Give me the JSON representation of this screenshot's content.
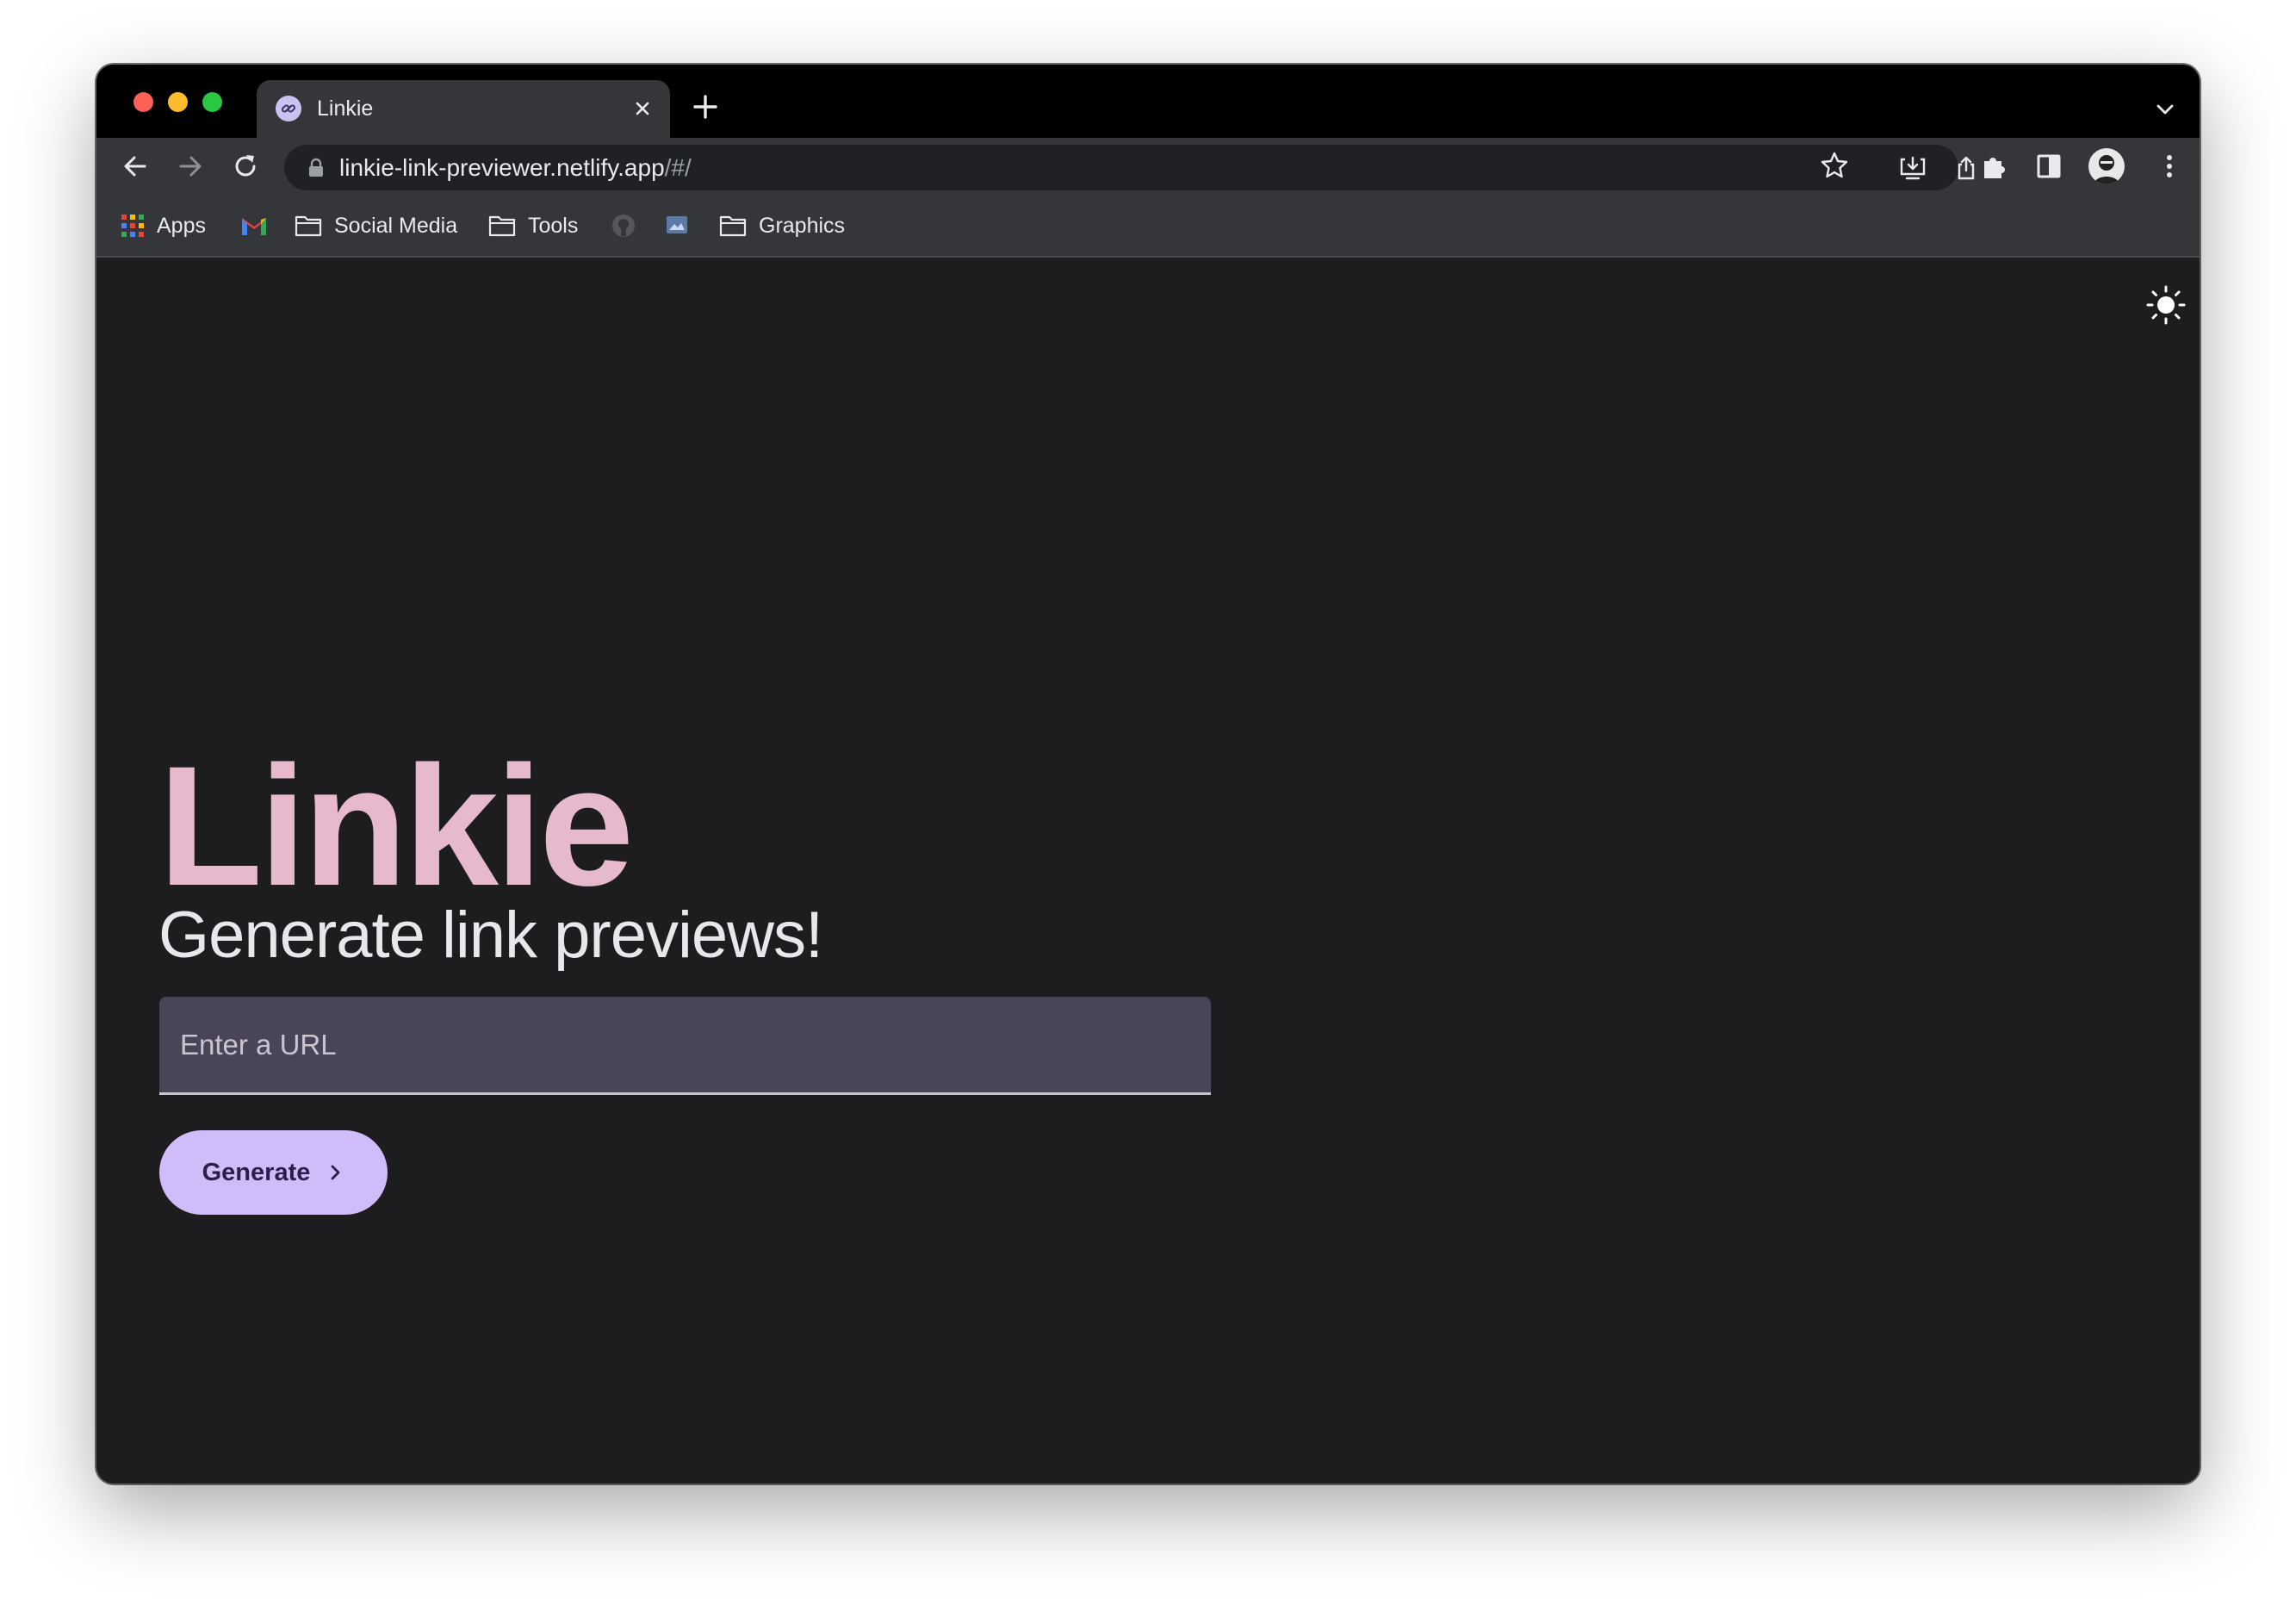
{
  "browser": {
    "tab": {
      "title": "Linkie"
    },
    "address_bar": {
      "url_main": "linkie-link-previewer.netlify.app",
      "url_path": "/#/"
    },
    "bookmarks": [
      {
        "label": "Apps",
        "icon": "apps-grid-icon"
      },
      {
        "label": "",
        "icon": "gmail-icon"
      },
      {
        "label": "Social Media",
        "icon": "folder-icon"
      },
      {
        "label": "Tools",
        "icon": "folder-icon"
      },
      {
        "label": "",
        "icon": "github-icon"
      },
      {
        "label": "",
        "icon": "image-bookmark-icon"
      },
      {
        "label": "Graphics",
        "icon": "folder-icon"
      }
    ]
  },
  "page": {
    "title": "Linkie",
    "subtitle": "Generate link previews!",
    "url_input": {
      "placeholder": "Enter a URL",
      "value": ""
    },
    "generate_button": {
      "label": "Generate"
    }
  },
  "colors": {
    "page_background": "#1d1d1f",
    "title": "#e6b9cc",
    "input_background": "#4a4458",
    "button_background": "#cfbcf8"
  }
}
